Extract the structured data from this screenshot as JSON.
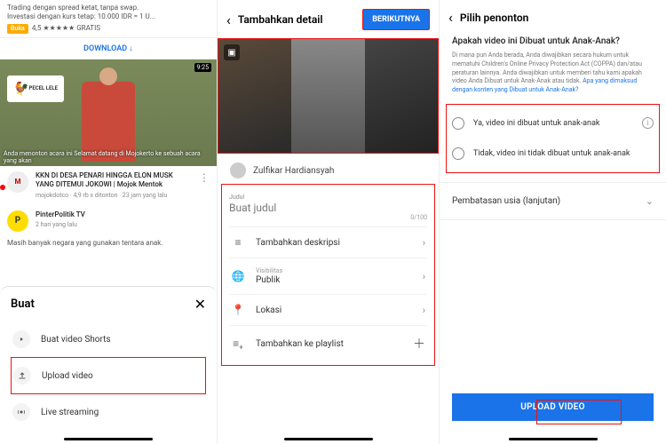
{
  "screen1": {
    "promo_line1": "Trading dengan spread ketat, tanpa swap.",
    "promo_line2": "Investasi dengan kurs tetap: 10.000 IDR = 1 U...",
    "promo_badge": "Buka",
    "promo_rating": "4,5 ★★★★★  GRATIS",
    "download": "DOWNLOAD ↓",
    "duration": "9:25",
    "sign": "PECEL LELE",
    "caption": "Anda menonton acara ini Selamat datang di Mojokerto ke sebuah acara yang akan",
    "video_title": "KKN DI DESA PENARI HINGGA ELON MUSK YANG DITEMUI JOKOWI | Mojok Mentok",
    "video_meta": "mojokdotco · 4,9 rb x ditonton · 23 jam yang lalu",
    "channel_name": "PinterPolitik TV",
    "channel_time": "2 hari yang lalu",
    "para": "Masih banyak negara yang gunakan tentara anak.",
    "sheet_title": "Buat",
    "opt_shorts": "Buat video Shorts",
    "opt_upload": "Upload video",
    "opt_live": "Live streaming"
  },
  "screen2": {
    "header": "Tambahkan detail",
    "next": "BERIKUTNYA",
    "user": "Zulfikar Hardiansyah",
    "judul_label": "Judul",
    "judul_value": "Buat judul",
    "judul_count": "0/100",
    "desc": "Tambahkan deskripsi",
    "vis_label": "Visibilitas",
    "vis_value": "Publik",
    "loc": "Lokasi",
    "playlist": "Tambahkan ke playlist"
  },
  "screen3": {
    "header": "Pilih penonton",
    "question": "Apakah video ini Dibuat untuk Anak-Anak?",
    "desc": "Di mana pun Anda berada, Anda diwajibkan secara hukum untuk mematuhi Children's Online Privacy Protection Act (COPPA) dan/atau peraturan lainnya. Anda diwajibkan untuk memberi tahu kami apakah video Anda Dibuat untuk Anak-Anak atau tidak. ",
    "desc_link": "Apa yang dimaksud dengan konten yang Dibuat untuk Anak-Anak?",
    "opt_yes": "Ya, video ini dibuat untuk anak-anak",
    "opt_no": "Tidak, video ini tidak dibuat untuk anak-anak",
    "age": "Pembatasan usia (lanjutan)",
    "upload": "UPLOAD VIDEO"
  }
}
